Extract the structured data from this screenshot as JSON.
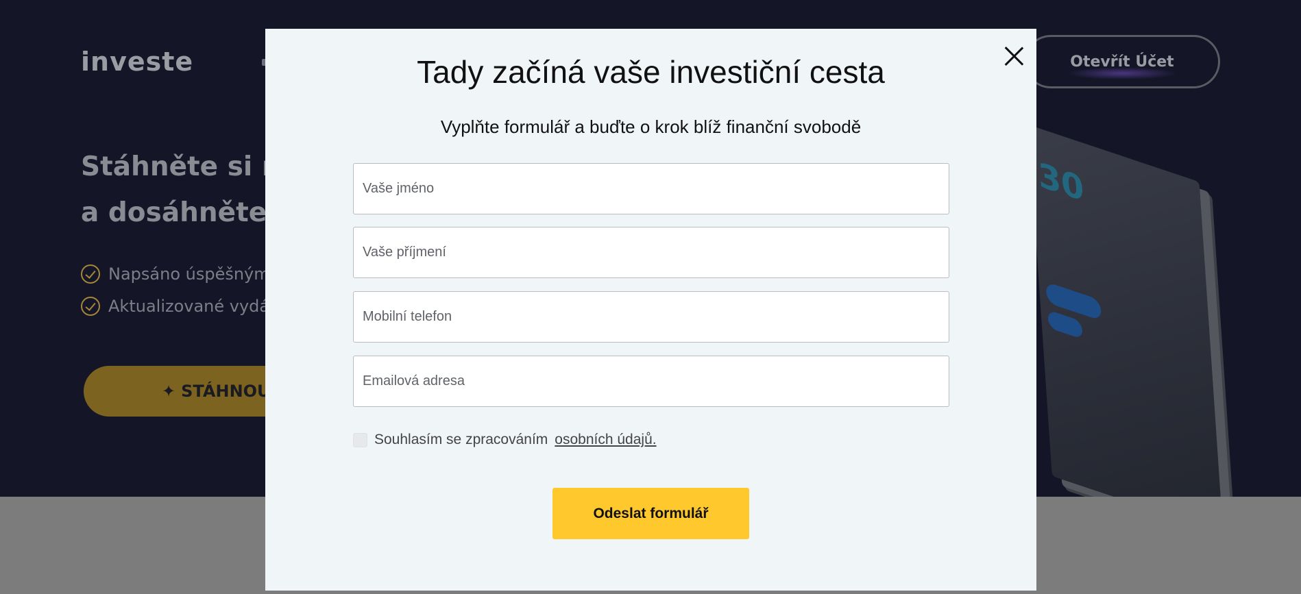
{
  "background": {
    "logo_text": "investe",
    "open_account_label": "Otevřít Účet",
    "hero_title_lines": [
      "Stáhněte si ná",
      "a dosáhněte n"
    ],
    "bullets": [
      "Napsáno úspěšným",
      "Aktualizované vydá"
    ],
    "download_label": "STÁHNOU",
    "book_number": "30",
    "colors": {
      "hero_bg": "#141628",
      "accent": "#ffc82c"
    }
  },
  "modal": {
    "title": "Tady začíná vaše investiční cesta",
    "subtitle": "Vyplňte formulář a buďte o krok blíž finanční svobodě",
    "fields": [
      {
        "name": "first-name",
        "placeholder": "Vaše jméno",
        "value": ""
      },
      {
        "name": "last-name",
        "placeholder": "Vaše příjmení",
        "value": ""
      },
      {
        "name": "phone",
        "placeholder": "Mobilní telefon",
        "value": ""
      },
      {
        "name": "email",
        "placeholder": "Emailová adresa",
        "value": ""
      }
    ],
    "consent_text": "Souhlasím se zpracováním",
    "consent_link": "osobních údajů.",
    "submit_label": "Odeslat formulář",
    "close_icon": "close-icon"
  }
}
